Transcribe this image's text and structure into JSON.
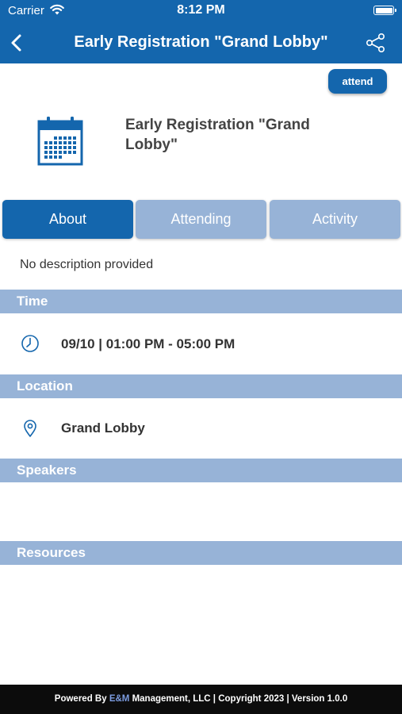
{
  "status_bar": {
    "carrier": "Carrier",
    "time": "8:12 PM"
  },
  "nav": {
    "title": "Early Registration \"Grand Lobby\"",
    "back_icon": "chevron-left-icon",
    "share_icon": "share-icon"
  },
  "event": {
    "attend_label": "attend",
    "title": "Early Registration \"Grand Lobby\"",
    "icon": "calendar-icon"
  },
  "tabs": [
    {
      "label": "About",
      "active": true
    },
    {
      "label": "Attending",
      "active": false
    },
    {
      "label": "Activity",
      "active": false
    }
  ],
  "about": {
    "description": "No description provided"
  },
  "sections": {
    "time": {
      "header": "Time",
      "value": "09/10 | 01:00 PM - 05:00 PM",
      "icon": "clock-icon"
    },
    "location": {
      "header": "Location",
      "value": "Grand Lobby",
      "icon": "map-pin-icon"
    },
    "speakers": {
      "header": "Speakers"
    },
    "resources": {
      "header": "Resources"
    }
  },
  "footer": {
    "prefix": "Powered By ",
    "brand": "E&M",
    "suffix": " Management, LLC | Copyright 2023 | Version 1.0.0"
  },
  "colors": {
    "primary": "#1466ad",
    "light": "#97b3d7",
    "footer": "#0c0c0c",
    "brand": "#7c9ce0"
  }
}
